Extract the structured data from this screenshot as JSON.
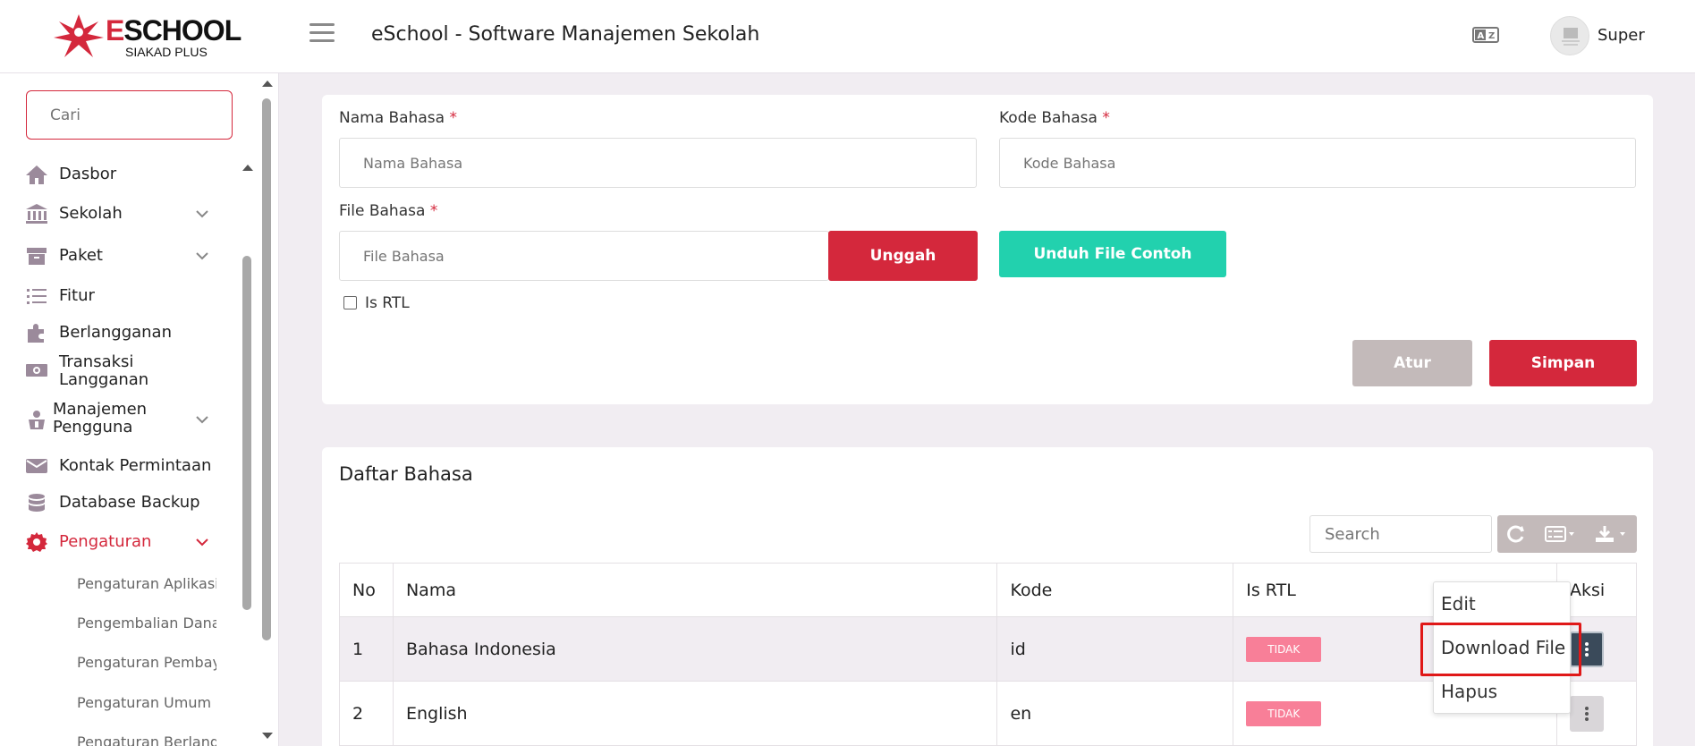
{
  "header": {
    "logo_text_e": "E",
    "logo_text_rest": "SCHOOL",
    "logo_sub": "SIAKAD PLUS",
    "title": "eSchool - Software Manajemen Sekolah",
    "user_name": "Super",
    "language_icon": "language-toggle-icon",
    "avatar_icon": "user-avatar"
  },
  "sidebar": {
    "search_placeholder": "Cari",
    "items": [
      {
        "label": "Dasbor",
        "icon": "home-icon"
      },
      {
        "label": "Sekolah",
        "icon": "bank-icon"
      },
      {
        "label": "Paket",
        "icon": "archive-icon"
      },
      {
        "label": "Fitur",
        "icon": "list-icon"
      },
      {
        "label": "Berlangganan",
        "icon": "puzzle-icon"
      },
      {
        "label": "Transaksi Langganan",
        "icon": "money-icon"
      },
      {
        "label": "Manajemen Pengguna",
        "icon": "user-manage-icon"
      },
      {
        "label": "Kontak Permintaan",
        "icon": "envelope-icon"
      },
      {
        "label": "Database Backup",
        "icon": "database-icon"
      },
      {
        "label": "Pengaturan",
        "icon": "gear-icon"
      }
    ],
    "sub_items": [
      "Pengaturan Aplikasi",
      "Pengembalian Dana",
      "Pengaturan Pembayaran",
      "Pengaturan Umum",
      "Pengaturan Berlangganan"
    ]
  },
  "form": {
    "name_label": "Nama Bahasa",
    "name_placeholder": "Nama Bahasa",
    "code_label": "Kode Bahasa",
    "code_placeholder": "Kode Bahasa",
    "file_label": "File Bahasa",
    "file_placeholder": "File Bahasa",
    "required_mark": "*",
    "upload_btn": "Unggah",
    "sample_btn": "Unduh File Contoh",
    "rtl_label": "Is RTL",
    "reset_btn": "Atur",
    "save_btn": "Simpan"
  },
  "list": {
    "title": "Daftar Bahasa",
    "search_placeholder": "Search",
    "columns": [
      "No",
      "Nama",
      "Kode",
      "Is RTL",
      "Aksi"
    ],
    "rows": [
      {
        "no": "1",
        "name": "Bahasa Indonesia",
        "code": "id",
        "rtl": "TIDAK"
      },
      {
        "no": "2",
        "name": "English",
        "code": "en",
        "rtl": "TIDAK"
      }
    ]
  },
  "dropdown": {
    "items": [
      "Edit",
      "Download File",
      "Hapus"
    ]
  },
  "colors": {
    "brand": "#d4283c",
    "teal": "#22d1ae",
    "gray_btn": "#c3baba",
    "badge": "#f87f98",
    "highlight": "#e01818"
  }
}
